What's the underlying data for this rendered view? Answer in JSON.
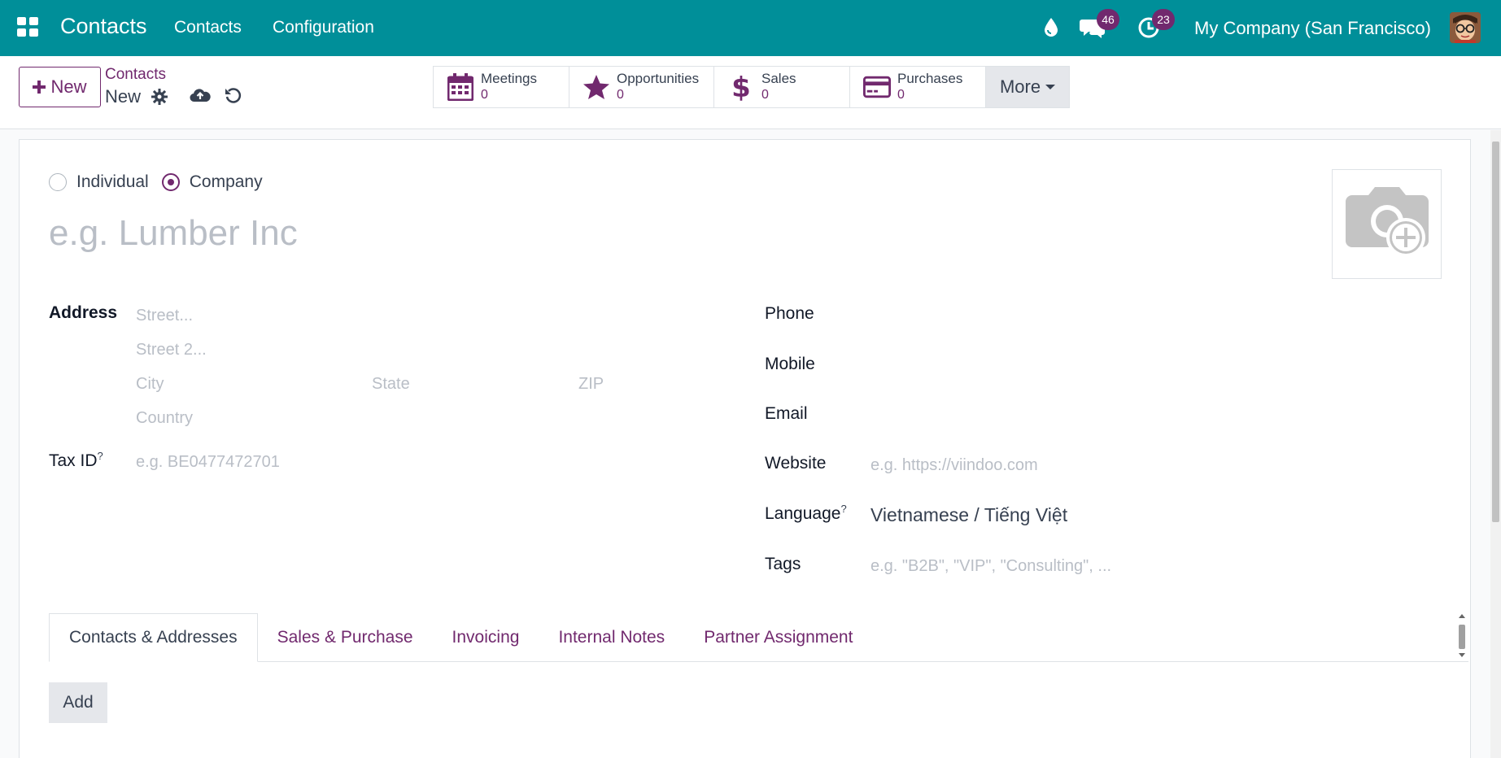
{
  "navbar": {
    "app_name": "Contacts",
    "menus": [
      "Contacts",
      "Configuration"
    ],
    "messages_count": "46",
    "activities_count": "23",
    "company": "My Company (San Francisco)",
    "bg_color": "#008f99",
    "badge_color": "#71296e"
  },
  "control_panel": {
    "new_label": "New",
    "breadcrumb_parent": "Contacts",
    "breadcrumb_current": "New",
    "smart_buttons": [
      {
        "label": "Meetings",
        "value": "0",
        "icon": "calendar-icon"
      },
      {
        "label": "Opportunities",
        "value": "0",
        "icon": "star-icon"
      },
      {
        "label": "Sales",
        "value": "0",
        "icon": "dollar-icon"
      },
      {
        "label": "Purchases",
        "value": "0",
        "icon": "credit-card-icon"
      }
    ],
    "more_label": "More"
  },
  "form": {
    "company_type": {
      "individual_label": "Individual",
      "company_label": "Company",
      "selected": "Company"
    },
    "name_placeholder": "e.g. Lumber Inc",
    "address_label": "Address",
    "street_placeholder": "Street...",
    "street2_placeholder": "Street 2...",
    "city_placeholder": "City",
    "state_placeholder": "State",
    "zip_placeholder": "ZIP",
    "country_placeholder": "Country",
    "tax_id_label": "Tax ID",
    "tax_id_placeholder": "e.g. BE0477472701",
    "help_mark": "?",
    "phone_label": "Phone",
    "mobile_label": "Mobile",
    "email_label": "Email",
    "website_label": "Website",
    "website_placeholder": "e.g. https://viindoo.com",
    "language_label": "Language",
    "language_value": "Vietnamese / Tiếng Việt",
    "tags_label": "Tags",
    "tags_placeholder": "e.g. \"B2B\", \"VIP\", \"Consulting\", ..."
  },
  "notebook": {
    "tabs": [
      "Contacts & Addresses",
      "Sales & Purchase",
      "Invoicing",
      "Internal Notes",
      "Partner Assignment"
    ],
    "active_tab": "Contacts & Addresses",
    "add_label": "Add"
  },
  "colors": {
    "accent": "#71296e",
    "placeholder": "#b9bec6"
  }
}
